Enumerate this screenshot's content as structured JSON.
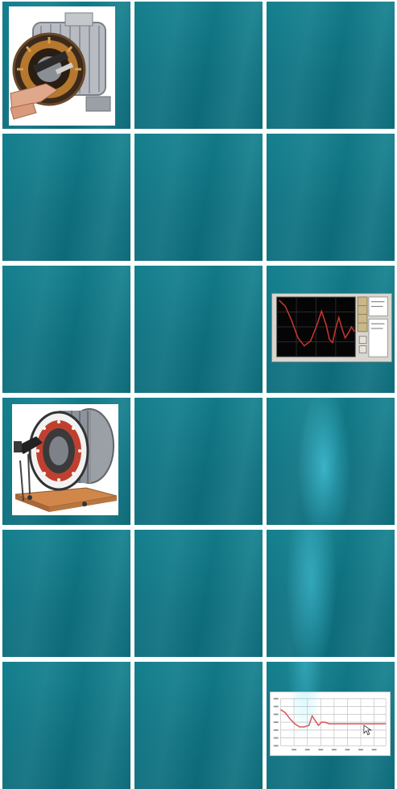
{
  "tiles": [
    {
      "id": "r1c1",
      "content": "motor-image",
      "icon": "electric-motor-icon"
    },
    {
      "id": "r1c2",
      "content": "empty"
    },
    {
      "id": "r1c3",
      "content": "empty"
    },
    {
      "id": "r2c1",
      "content": "empty"
    },
    {
      "id": "r2c2",
      "content": "empty"
    },
    {
      "id": "r2c3",
      "content": "empty"
    },
    {
      "id": "r3c1",
      "content": "empty"
    },
    {
      "id": "r3c2",
      "content": "empty"
    },
    {
      "id": "r3c3",
      "content": "oscilloscope-image",
      "icon": "waveform-icon"
    },
    {
      "id": "r4c1",
      "content": "stator-image",
      "icon": "stator-rig-icon"
    },
    {
      "id": "r4c2",
      "content": "empty"
    },
    {
      "id": "r4c3",
      "content": "empty"
    },
    {
      "id": "r5c1",
      "content": "empty"
    },
    {
      "id": "r5c2",
      "content": "empty"
    },
    {
      "id": "r5c3",
      "content": "empty"
    },
    {
      "id": "r6c1",
      "content": "empty"
    },
    {
      "id": "r6c2",
      "content": "empty"
    },
    {
      "id": "r6c3",
      "content": "line-plot-image",
      "icon": "line-chart-icon"
    }
  ],
  "colors": {
    "tile_teal": "#117a89",
    "tile_highlight": "#5ae6ff",
    "grid_gap": "#ffffff",
    "scope_screen": "#050505",
    "scope_trace": "#c8342e",
    "plot_line": "#e0555a",
    "plot_grid": "#c8c8c8"
  }
}
